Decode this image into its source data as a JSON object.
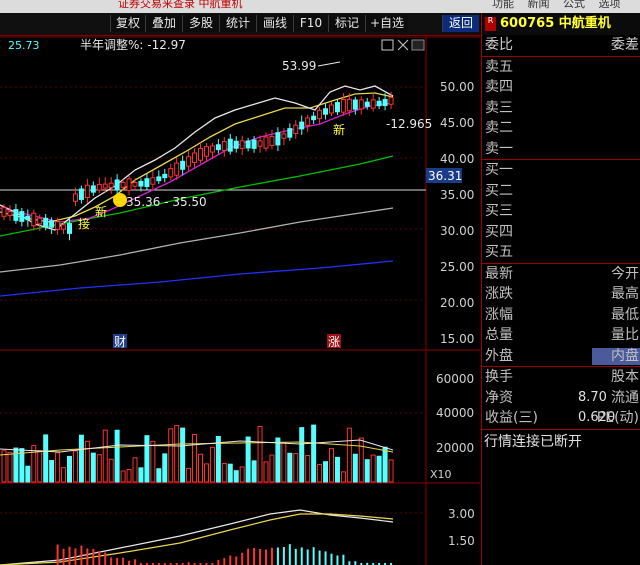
{
  "top_strip": {
    "left_text": "证券交易来查录 中航重机",
    "right_text": "功能 新闻 公式 选项"
  },
  "toolbar": {
    "buttons": [
      "复权",
      "叠加",
      "多股",
      "统计",
      "画线",
      "F10",
      "标记",
      "+自选",
      "返回"
    ]
  },
  "main_chart": {
    "left_value": "25.73",
    "indicator_label": "半年调整%: -12.97",
    "high_label": "53.99",
    "change_label": "-12.965",
    "low_label": "35.36 - 35.50",
    "current_price_tag": "36.31",
    "price_axis": [
      "50.00",
      "45.00",
      "40.00",
      "35.00",
      "30.00",
      "25.00",
      "20.00",
      "15.00"
    ],
    "markers": {
      "fu": "复",
      "cai": "财",
      "zhang": "涨",
      "xin1": "新",
      "xin2": "新",
      "jie": "接"
    }
  },
  "volume_panel": {
    "axis": [
      "60000",
      "40000",
      "20000"
    ],
    "unit": "X10"
  },
  "macd_panel": {
    "axis": [
      "3.00",
      "1.50"
    ]
  },
  "right_panel": {
    "stock_badge": "R",
    "stock_code": "600765 中航重机",
    "order_header": {
      "left": "委比",
      "right": "委差"
    },
    "asks": [
      "卖五",
      "卖四",
      "卖三",
      "卖二",
      "卖一"
    ],
    "bids": [
      "买一",
      "买二",
      "买三",
      "买四",
      "买五"
    ],
    "stats": [
      {
        "left": "最新",
        "right": "今开"
      },
      {
        "left": "涨跌",
        "right": "最高"
      },
      {
        "left": "涨幅",
        "right": "最低"
      },
      {
        "left": "总量",
        "right": "量比"
      },
      {
        "left": "外盘",
        "right": "内盘"
      }
    ],
    "fundamentals": [
      {
        "left": "换手",
        "value": "",
        "right": "股本"
      },
      {
        "left": "净资",
        "value": "8.70",
        "right": "流通"
      },
      {
        "left": "收益(三)",
        "value": "0.620",
        "right": "PE(动)"
      }
    ],
    "status": "行情连接已断开"
  },
  "colors": {
    "ma_white": "#e8e8e8",
    "ma_yellow": "#e8d84a",
    "ma_magenta": "#d020d0",
    "ma_green": "#00c000",
    "ma_gray": "#b0b0b0",
    "ma_blue": "#2030ff",
    "up": "#ff3232",
    "down": "#54ffff",
    "frame": "#a00000"
  }
}
